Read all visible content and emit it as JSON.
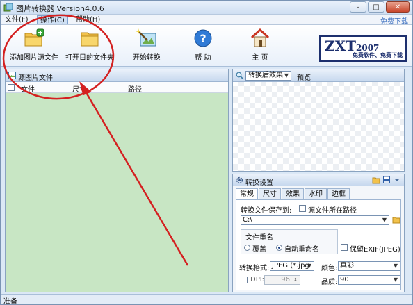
{
  "window": {
    "title": "图片转换器 Version4.0.6"
  },
  "menu": {
    "items": [
      "文件(F)",
      "操作(C)",
      "帮助(H)"
    ],
    "active_index": 1,
    "right_link": "免费下载"
  },
  "toolbar": {
    "buttons": [
      {
        "label": "添加图片源文件",
        "icon": "add-folder-icon"
      },
      {
        "label": "打开目的文件夹",
        "icon": "folder-icon"
      },
      {
        "label": "开始转换",
        "icon": "convert-wand-icon"
      },
      {
        "label": "帮 助",
        "icon": "help-icon"
      },
      {
        "label": "主 页",
        "icon": "home-icon"
      }
    ],
    "logo": {
      "main": "ZXT",
      "year": "2007",
      "tagline": "免费软件、免费下载"
    }
  },
  "source_panel": {
    "title": "源图片文件",
    "columns": [
      "文件",
      "尺寸",
      "路径"
    ]
  },
  "preview_panel": {
    "effect_select": "转换后效果",
    "label": "预览"
  },
  "settings_panel": {
    "title": "转换设置",
    "tabs": [
      "常规",
      "尺寸",
      "效果",
      "水印",
      "边框"
    ],
    "active_tab": 0,
    "save_to_label": "转换文件保存到:",
    "source_path_label": "源文件所在路径",
    "save_path": "C:\\",
    "rename_title": "文件重名",
    "rename_options": [
      "覆盖",
      "自动重命名"
    ],
    "rename_selected": 1,
    "keep_exif_label": "保留EXIF(JPEG)",
    "format_label": "转换格式:",
    "format_value": "JPEG (*.jpg",
    "color_label": "颜色:",
    "color_value": "真彩",
    "dpi_label": "DPI:",
    "dpi_value": "96",
    "quality_label": "品质:",
    "quality_value": "90"
  },
  "status_bar": {
    "text": "准备"
  },
  "colors": {
    "annotation_red": "#d42020",
    "list_background": "#c8e6c4",
    "logo_navy": "#1c2f6e"
  }
}
